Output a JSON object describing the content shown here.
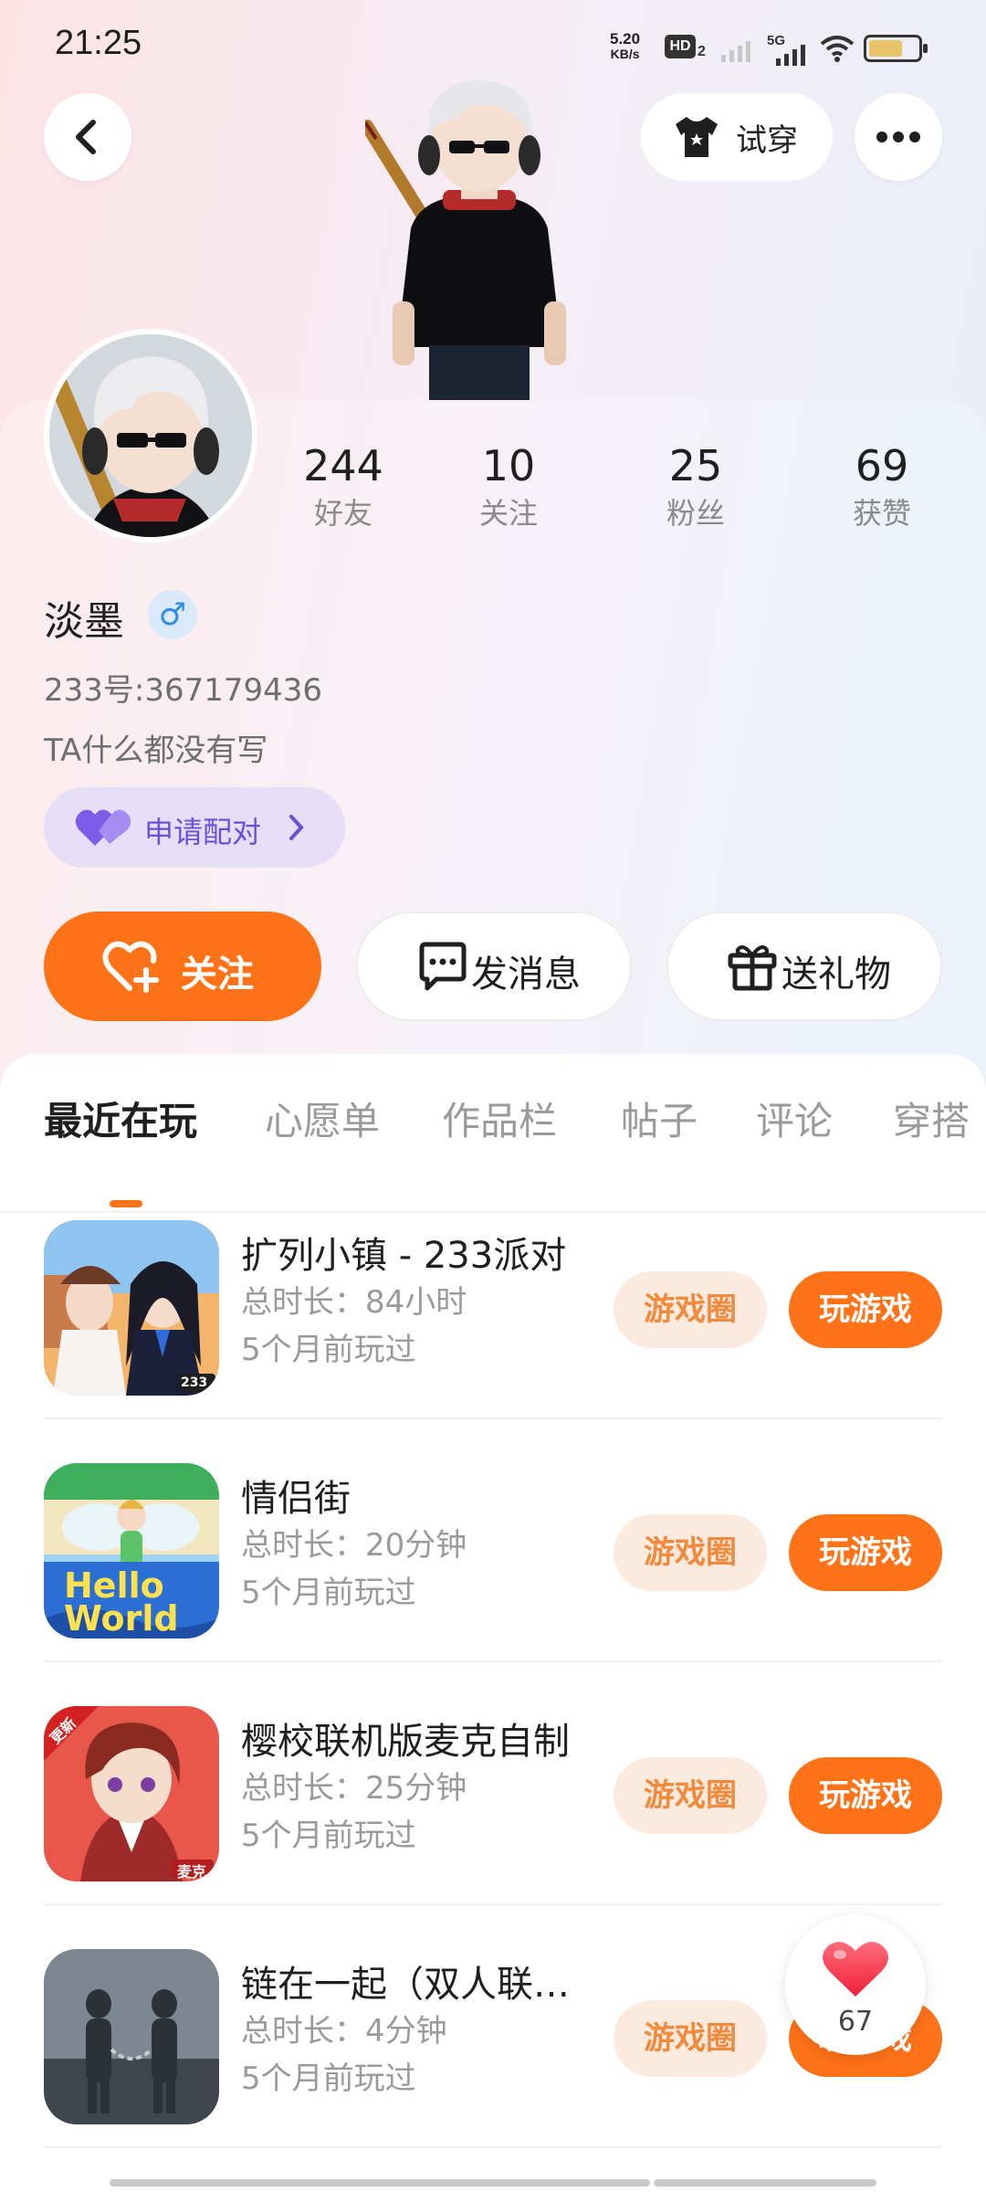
{
  "status_bar": {
    "time": "21:25",
    "net_speed_value": "5.20",
    "net_speed_unit": "KB/s",
    "hd_label": "HD",
    "hd_sub": "2",
    "network": "5G"
  },
  "header": {
    "tryon_label": "试穿"
  },
  "profile": {
    "nickname": "淡墨",
    "gender_symbol": "♂",
    "user_id": "233号:367179436",
    "bio": "TA什么都没有写",
    "match_label": "申请配对",
    "stats": [
      {
        "value": "244",
        "label": "好友"
      },
      {
        "value": "10",
        "label": "关注"
      },
      {
        "value": "25",
        "label": "粉丝"
      },
      {
        "value": "69",
        "label": "获赞"
      }
    ]
  },
  "actions": {
    "follow": "关注",
    "message": "发消息",
    "gift": "送礼物"
  },
  "tabs": [
    "最近在玩",
    "心愿单",
    "作品栏",
    "帖子",
    "评论",
    "穿搭"
  ],
  "active_tab": "最近在玩",
  "games": [
    {
      "title": "扩列小镇 - 233派对",
      "duration": "总时长：84小时",
      "last_played": "5个月前玩过",
      "circle_label": "游戏圈",
      "play_label": "玩游戏",
      "icon_badge": "233"
    },
    {
      "title": "情侣街",
      "duration": "总时长：20分钟",
      "last_played": "5个月前玩过",
      "circle_label": "游戏圈",
      "play_label": "玩游戏",
      "icon_text_1": "Hello",
      "icon_text_2": "World"
    },
    {
      "title": "樱校联机版麦克自制",
      "duration": "总时长：25分钟",
      "last_played": "5个月前玩过",
      "circle_label": "游戏圈",
      "play_label": "玩游戏",
      "icon_ribbon": "更新",
      "icon_badge": "麦克"
    },
    {
      "title": "链在一起（双人联…",
      "duration": "总时长：4分钟",
      "last_played": "5个月前玩过",
      "circle_label": "游戏圈",
      "play_label": "玩游戏"
    }
  ],
  "floating_likes": {
    "count": "67"
  },
  "colors": {
    "accent": "#ff7217",
    "accent_soft": "#fdeadf",
    "match_purple": "#6b4fd6",
    "gender_blue": "#2f8de4"
  }
}
